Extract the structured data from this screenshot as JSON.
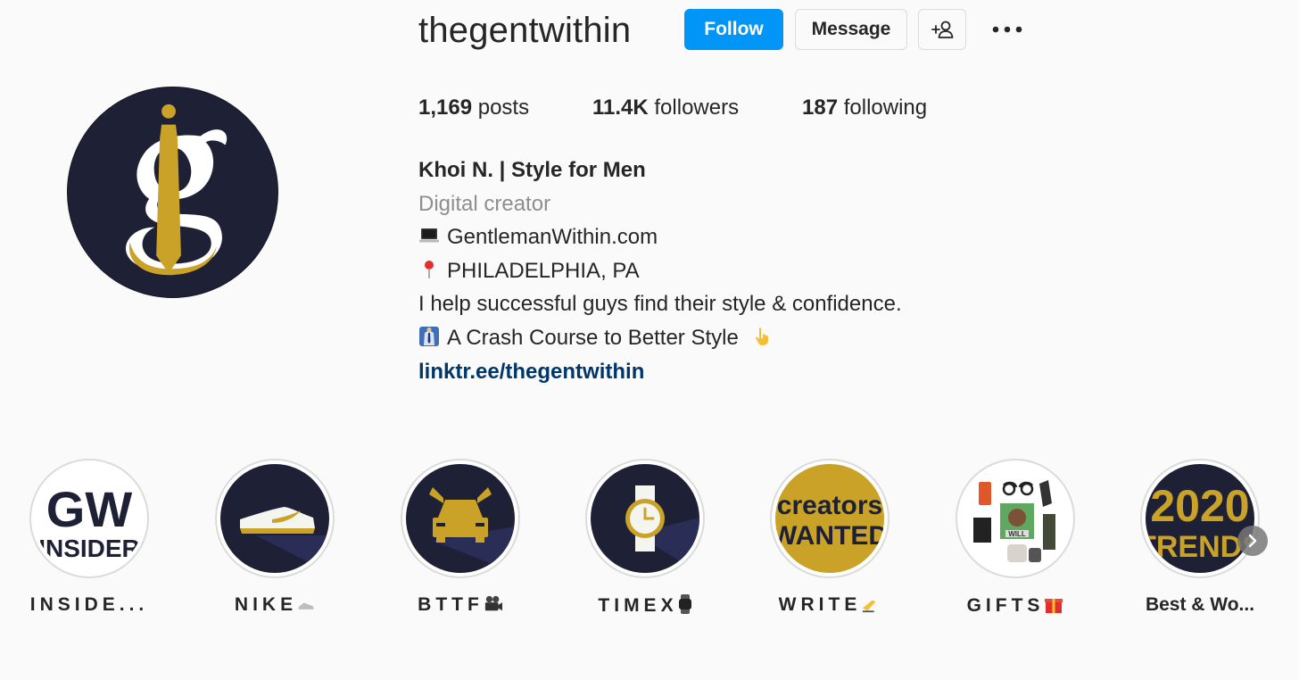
{
  "profile": {
    "username": "thegentwithin",
    "avatar_icon": "gw-monogram-logo"
  },
  "actions": {
    "follow_label": "Follow",
    "message_label": "Message",
    "suggest_icon": "add-person-icon",
    "more_icon": "more-options-icon"
  },
  "stats": {
    "posts_count": "1,169",
    "posts_label": "posts",
    "followers_count": "11.4K",
    "followers_label": "followers",
    "following_count": "187",
    "following_label": "following"
  },
  "bio": {
    "name": "Khoi N. | Style for Men",
    "category": "Digital creator",
    "website_emoji": "laptop-icon",
    "website": "GentlemanWithin.com",
    "location_emoji": "pin-icon",
    "location": "PHILADELPHIA, PA",
    "tagline": "I help successful guys find their style & confidence.",
    "course_emoji": "suit-icon",
    "course": "A Crash Course to Better Style",
    "course_trailing_emoji": "pointing-down-icon",
    "link": "linktr.ee/thegentwithin"
  },
  "highlights": [
    {
      "label": "INSIDE...",
      "icon": "gw-insider-icon",
      "title_line1": "GW",
      "title_line2": "INSIDER"
    },
    {
      "label": "NIKE",
      "icon": "sneaker-icon",
      "label_emoji": "shoe-icon"
    },
    {
      "label": "BTTF",
      "icon": "delorean-icon",
      "label_emoji": "camera-icon"
    },
    {
      "label": "TIMEX",
      "icon": "watch-icon",
      "label_emoji": "watch-icon"
    },
    {
      "label": "WRITE",
      "icon": "creators-wanted-icon",
      "label_emoji": "writing-hand-icon",
      "title_line1": "creators",
      "title_line2": "WANTED"
    },
    {
      "label": "GIFTS",
      "icon": "gifts-collage-icon",
      "label_emoji": "gift-icon",
      "center_text": "WILL"
    },
    {
      "label": "Best & Wo...",
      "icon": "trends-2020-icon",
      "title_line1": "2020",
      "title_line2": "TRENDS"
    }
  ],
  "colors": {
    "primary_blue": "#0095f6",
    "link_blue": "#00376b",
    "navy": "#1e2036",
    "gold": "#c9a227"
  }
}
